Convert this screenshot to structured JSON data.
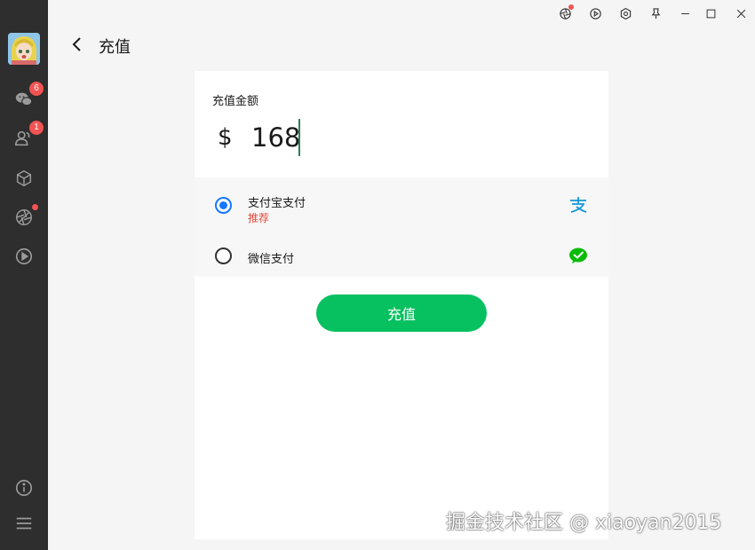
{
  "sidebar": {
    "avatar_alt": "",
    "items": [
      {
        "icon": "chat-icon",
        "badge": "6"
      },
      {
        "icon": "contacts-icon",
        "badge": "1"
      },
      {
        "icon": "cube-icon",
        "badge": ""
      },
      {
        "icon": "aperture-icon",
        "dot": true
      },
      {
        "icon": "play-circle-icon",
        "badge": ""
      }
    ],
    "bottom": [
      {
        "icon": "info-icon"
      },
      {
        "icon": "menu-icon"
      }
    ]
  },
  "titlebar": {
    "buttons": [
      "aperture-icon",
      "play-icon",
      "settings-icon",
      "pin-icon",
      "minimize-icon",
      "maximize-icon",
      "close-icon"
    ]
  },
  "header": {
    "title": "充值"
  },
  "recharge": {
    "amount_label": "充值金额",
    "currency": "$",
    "amount_value": "168",
    "methods": [
      {
        "name": "支付宝支付",
        "tag": "推荐",
        "selected": true,
        "icon": "alipay-icon"
      },
      {
        "name": "微信支付",
        "tag": "",
        "selected": false,
        "icon": "wechat-pay-icon"
      }
    ],
    "submit_label": "充值"
  },
  "watermark": "掘金技术社区 @ xiaoyan2015",
  "colors": {
    "sidebar_bg": "#2e2e2e",
    "accent_green": "#07c160",
    "radio_blue": "#1677ff",
    "badge_red": "#f25353",
    "tag_red": "#e14b3b"
  }
}
